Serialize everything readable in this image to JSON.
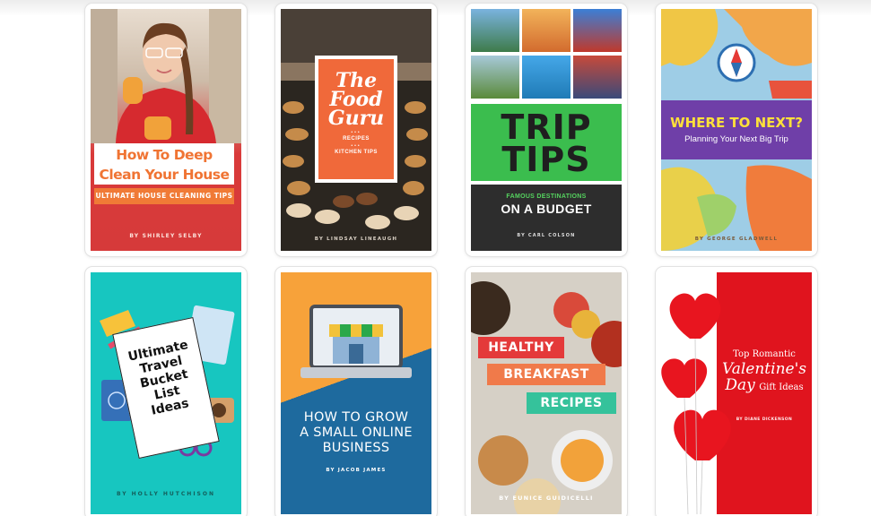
{
  "covers": [
    {
      "title_line1": "How To Deep",
      "title_line2": "Clean Your House",
      "subtitle": "ULTIMATE HOUSE CLEANING TIPS",
      "author": "BY SHIRLEY SELBY"
    },
    {
      "title_line1": "The",
      "title_line2": "Food",
      "title_line3": "Guru",
      "item1": "RECIPES",
      "item2": "KITCHEN TIPS",
      "author": "BY LINDSAY LINEAUGH"
    },
    {
      "title_line1": "TRIP",
      "title_line2": "TIPS",
      "kicker": "FAMOUS DESTINATIONS",
      "subtitle": "ON A BUDGET",
      "author": "BY CARL COLSON"
    },
    {
      "title": "WHERE TO NEXT?",
      "subtitle": "Planning Your Next Big Trip",
      "author": "BY GEORGE GLADWELL"
    },
    {
      "title_line1": "Ultimate",
      "title_line2": "Travel",
      "title_line3": "Bucket",
      "title_line4": "List",
      "title_line5": "Ideas",
      "author": "BY HOLLY HUTCHISON"
    },
    {
      "title_line1": "HOW TO GROW",
      "title_line2": "A SMALL ONLINE",
      "title_line3": "BUSINESS",
      "author": "BY JACOB JAMES"
    },
    {
      "title_line1": "HEALTHY",
      "title_line2": "BREAKFAST",
      "title_line3": "RECIPES",
      "author": "BY EUNICE GUIDICELLI"
    },
    {
      "title_line1": "Top Romantic",
      "title_line2": "Valentine's",
      "title_line3": "Day",
      "title_line3b": "Gift Ideas",
      "author": "BY DIANE DICKENSON"
    }
  ],
  "colors": {
    "orange": "#f07433",
    "trip_green": "#3bbd4e",
    "purple_band": "#6f3fa8",
    "teal": "#17c6c0",
    "valentine_red": "#e0141e"
  }
}
